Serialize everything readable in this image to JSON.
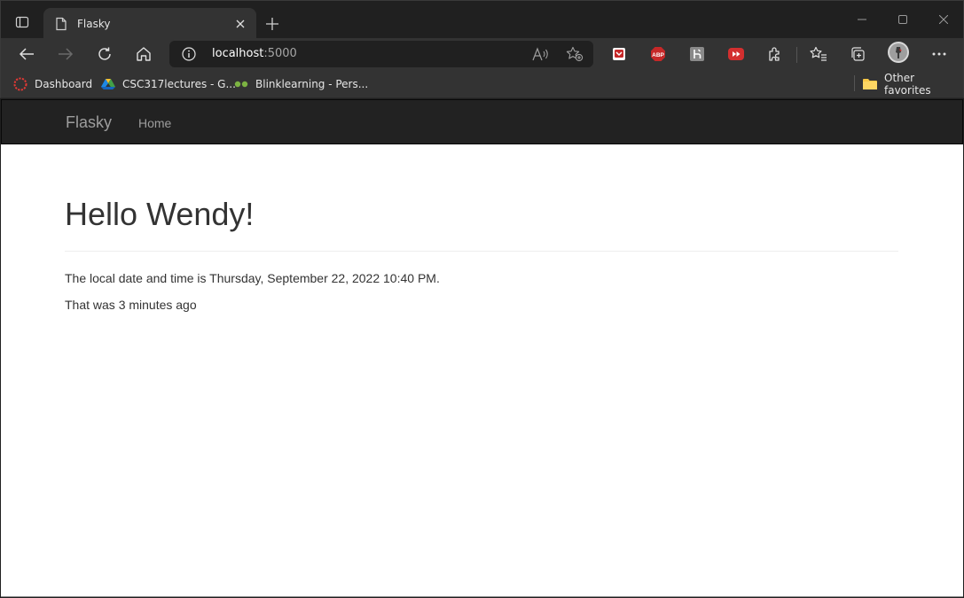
{
  "browser": {
    "tab": {
      "title": "Flasky"
    },
    "address": {
      "host": "localhost",
      "port": ":5000"
    },
    "favorites": [
      {
        "label": "Dashboard"
      },
      {
        "label": "CSC317lectures - G..."
      },
      {
        "label": "Blinklearning - Pers..."
      }
    ],
    "other_favorites": "Other favorites",
    "extensions": [
      "pocket-icon",
      "adblock-plus-icon",
      "h-extension-icon",
      "video-speed-icon",
      "extensions-puzzle-icon"
    ],
    "colors": {
      "frame": "#202020",
      "toolbar": "#333333",
      "abp_red": "#c62828"
    }
  },
  "page": {
    "navbar": {
      "brand": "Flasky",
      "home": "Home",
      "bg": "#222222"
    },
    "heading": "Hello Wendy!",
    "local_time_text": "The local date and time is Thursday, September 22, 2022 10:40 PM.",
    "ago_text": "That was 3 minutes ago"
  }
}
